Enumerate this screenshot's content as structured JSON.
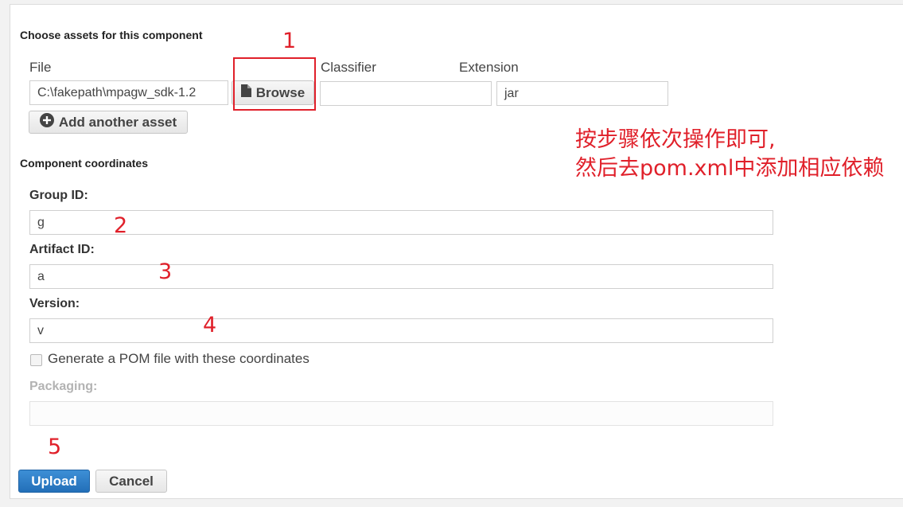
{
  "assets": {
    "section_title": "Choose assets for this component",
    "columns": {
      "file": "File",
      "classifier": "Classifier",
      "extension": "Extension"
    },
    "file_value": "C:\\fakepath\\mpagw_sdk-1.2",
    "browse_label": "Browse",
    "classifier_value": "",
    "extension_value": "jar",
    "add_asset_label": "Add another asset"
  },
  "coordinates": {
    "section_title": "Component coordinates",
    "group_id_label": "Group ID:",
    "group_id_value": "g",
    "artifact_id_label": "Artifact ID:",
    "artifact_id_value": "a",
    "version_label": "Version:",
    "version_value": "v",
    "generate_pom_label": "Generate a POM file with these coordinates",
    "generate_pom_checked": false,
    "packaging_label": "Packaging:",
    "packaging_value": ""
  },
  "actions": {
    "upload_label": "Upload",
    "cancel_label": "Cancel"
  },
  "annotations": {
    "step1": "1",
    "step2": "2",
    "step3": "3",
    "step4": "4",
    "step5": "5",
    "note_line1": "按步骤依次操作即可,",
    "note_line2": "然后去pom.xml中添加相应依赖",
    "color": "#e0202a"
  },
  "colors": {
    "primary": "#2a78c2",
    "panel_bg": "#ffffff",
    "page_bg": "#f2f2f2"
  }
}
